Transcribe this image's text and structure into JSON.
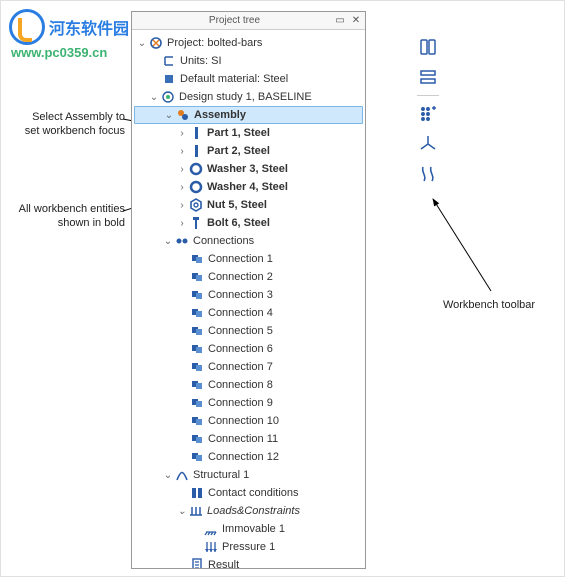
{
  "watermark": {
    "brand": "河东软件园",
    "url": "www.pc0359.cn"
  },
  "panel": {
    "title": "Project tree"
  },
  "tree": {
    "project": {
      "label": "Project: bolted-bars"
    },
    "units": {
      "label": "Units:   SI"
    },
    "material": {
      "label": "Default material: Steel"
    },
    "study": {
      "label": "Design study 1, BASELINE"
    },
    "assembly": {
      "label": "Assembly"
    },
    "parts": [
      {
        "label": "Part 1, Steel"
      },
      {
        "label": "Part 2, Steel"
      },
      {
        "label": "Washer 3, Steel"
      },
      {
        "label": "Washer 4, Steel"
      },
      {
        "label": "Nut 5, Steel"
      },
      {
        "label": "Bolt 6, Steel"
      }
    ],
    "connections_label": "Connections",
    "connections": [
      {
        "label": "Connection 1"
      },
      {
        "label": "Connection 2"
      },
      {
        "label": "Connection 3"
      },
      {
        "label": "Connection 4"
      },
      {
        "label": "Connection 5"
      },
      {
        "label": "Connection 6"
      },
      {
        "label": "Connection 7"
      },
      {
        "label": "Connection 8"
      },
      {
        "label": "Connection 9"
      },
      {
        "label": "Connection 10"
      },
      {
        "label": "Connection 11"
      },
      {
        "label": "Connection 12"
      }
    ],
    "structural_label": "Structural  1",
    "contact_label": "Contact conditions",
    "loads_label": "Loads&Constraints",
    "immovable_label": "Immovable 1",
    "pressure_label": "Pressure 1",
    "result_label": "Result"
  },
  "annotations": {
    "select_assembly": "Select Assembly to\nset workbench focus",
    "bold_entities": "All workbench entities\nshown in bold",
    "toolbar": "Workbench toolbar"
  }
}
